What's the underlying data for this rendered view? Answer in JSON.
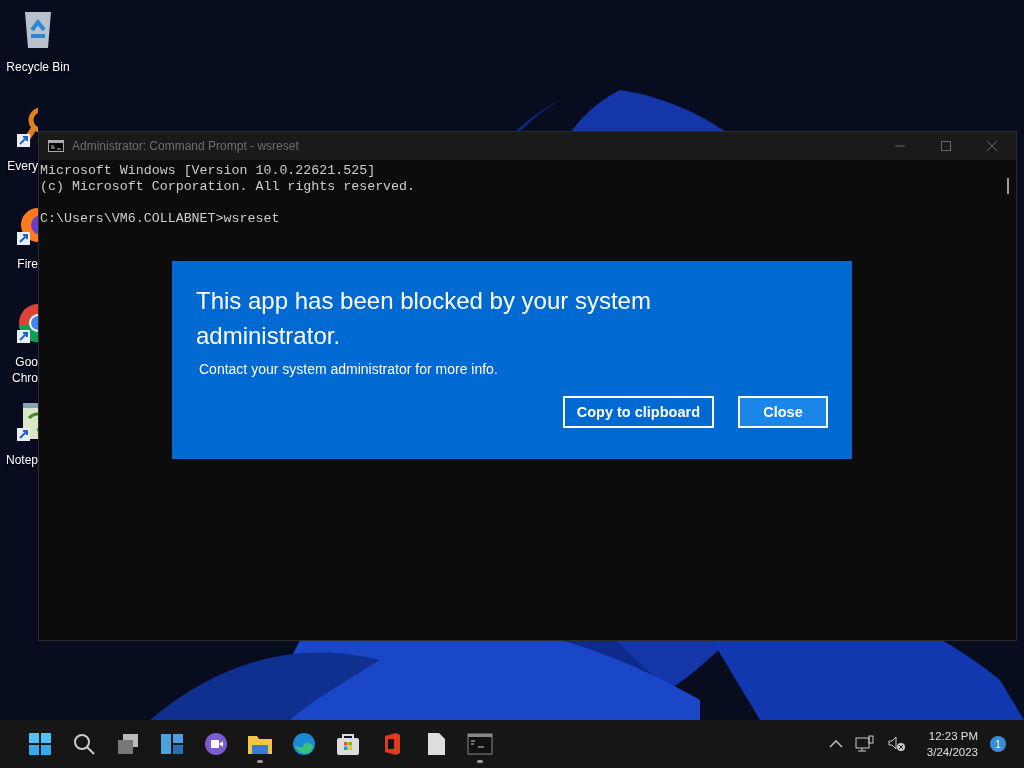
{
  "desktop": {
    "icons": [
      {
        "kind": "recycle-bin",
        "label": "Recycle Bin",
        "clipped": false,
        "shortcut": false
      },
      {
        "kind": "magnifier",
        "label": "Every",
        "clipped": true,
        "shortcut": true
      },
      {
        "kind": "firefox",
        "label": "Fire",
        "clipped": true,
        "shortcut": true
      },
      {
        "kind": "chrome",
        "label": "Goo Chro",
        "clipped": true,
        "shortcut": true
      },
      {
        "kind": "notepad",
        "label": "Notep",
        "clipped": true,
        "shortcut": true
      }
    ]
  },
  "console_window": {
    "title": "Administrator:  Command Prompt - wsreset",
    "output": [
      "Microsoft Windows [Version 10.0.22621.525]",
      "(c) Microsoft Corporation. All rights reserved."
    ],
    "prompt": "C:\\Users\\VM6.COLLABNET>wsreset"
  },
  "blocked_dialog": {
    "title": "This app has been blocked by your system administrator.",
    "message": "Contact your system administrator for more info.",
    "buttons": [
      {
        "label": "Copy to clipboard",
        "hovered": false
      },
      {
        "label": "Close",
        "hovered": true
      }
    ]
  },
  "taskbar": {
    "items": [
      {
        "kind": "start",
        "running": false
      },
      {
        "kind": "search",
        "running": false
      },
      {
        "kind": "task-view",
        "running": false
      },
      {
        "kind": "widgets",
        "running": false
      },
      {
        "kind": "chat",
        "running": false
      },
      {
        "kind": "folder",
        "running": true
      },
      {
        "kind": "edge",
        "running": false
      },
      {
        "kind": "store",
        "running": false
      },
      {
        "kind": "office",
        "running": false
      },
      {
        "kind": "file",
        "running": false
      },
      {
        "kind": "terminal",
        "running": true
      }
    ],
    "time": "12:23 PM",
    "date": "3/24/2023",
    "notification_count": "1"
  }
}
